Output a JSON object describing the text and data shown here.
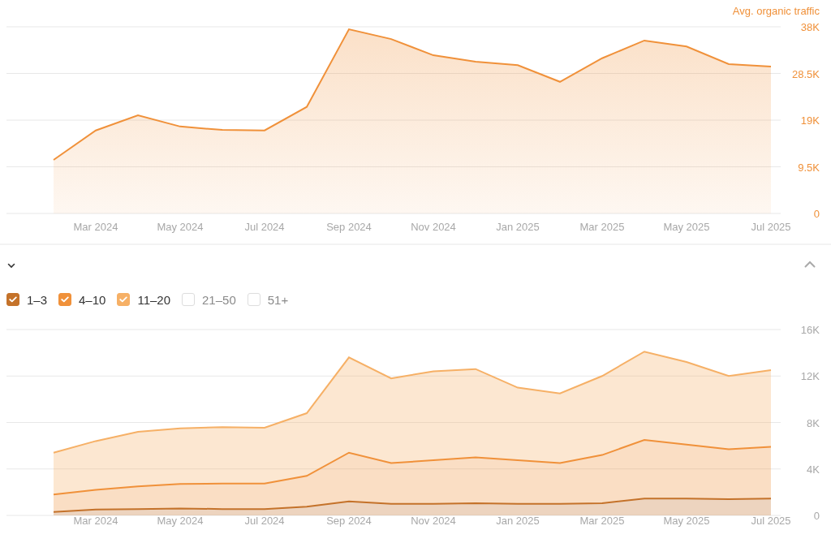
{
  "traffic_chart": {
    "chart_data": {
      "type": "area",
      "categories": [
        null,
        "Mar 2024",
        null,
        "May 2024",
        null,
        "Jul 2024",
        null,
        "Sep 2024",
        null,
        "Nov 2024",
        null,
        "Jan 2025",
        null,
        "Mar 2025",
        null,
        "May 2025",
        null,
        "Jul 2025"
      ],
      "yticks": [
        {
          "value": 0,
          "label": "0"
        },
        {
          "value": 9500,
          "label": "9.5K"
        },
        {
          "value": 19000,
          "label": "19K"
        },
        {
          "value": 28500,
          "label": "28.5K"
        },
        {
          "value": 38000,
          "label": "38K"
        }
      ],
      "ylim": [
        0,
        38000
      ],
      "grid": true,
      "series": [
        {
          "name": "Avg. organic traffic",
          "color": "#f0913a",
          "values": [
            10900,
            16900,
            20000,
            17700,
            17000,
            16900,
            21700,
            37500,
            35500,
            32200,
            30900,
            30200,
            26800,
            31600,
            35200,
            34000,
            30400,
            29900
          ]
        }
      ]
    }
  },
  "positions_chart": {
    "legend": [
      {
        "label": "1–3",
        "checked": true,
        "color": "#c4722a"
      },
      {
        "label": "4–10",
        "checked": true,
        "color": "#f0913a"
      },
      {
        "label": "11–20",
        "checked": true,
        "color": "#f6b066"
      },
      {
        "label": "21–50",
        "checked": false
      },
      {
        "label": "51+",
        "checked": false
      }
    ],
    "chart_data": {
      "type": "area",
      "stacked": true,
      "categories": [
        null,
        "Mar 2024",
        null,
        "May 2024",
        null,
        "Jul 2024",
        null,
        "Sep 2024",
        null,
        "Nov 2024",
        null,
        "Jan 2025",
        null,
        "Mar 2025",
        null,
        "May 2025",
        null,
        "Jul 2025"
      ],
      "yticks": [
        {
          "value": 0,
          "label": "0"
        },
        {
          "value": 4000,
          "label": "4K"
        },
        {
          "value": 8000,
          "label": "8K"
        },
        {
          "value": 12000,
          "label": "12K"
        },
        {
          "value": 16000,
          "label": "16K"
        }
      ],
      "ylim": [
        0,
        16000
      ],
      "grid": true,
      "series": [
        {
          "color": "#c4722a",
          "values": [
            300,
            500,
            550,
            600,
            550,
            550,
            750,
            1200,
            1000,
            1000,
            1050,
            1000,
            1000,
            1050,
            1450,
            1450,
            1400,
            1450
          ]
        },
        {
          "color": "#f0913a",
          "values": [
            1500,
            1700,
            1950,
            2100,
            2200,
            2200,
            2650,
            4200,
            3500,
            3750,
            3950,
            3750,
            3500,
            4150,
            5050,
            4650,
            4300,
            4450
          ]
        },
        {
          "color": "#f6b066",
          "values": [
            3600,
            4200,
            4700,
            4800,
            4850,
            4800,
            5400,
            8200,
            7300,
            7650,
            7600,
            6250,
            6000,
            6800,
            7600,
            7100,
            6300,
            6600
          ]
        }
      ]
    }
  }
}
